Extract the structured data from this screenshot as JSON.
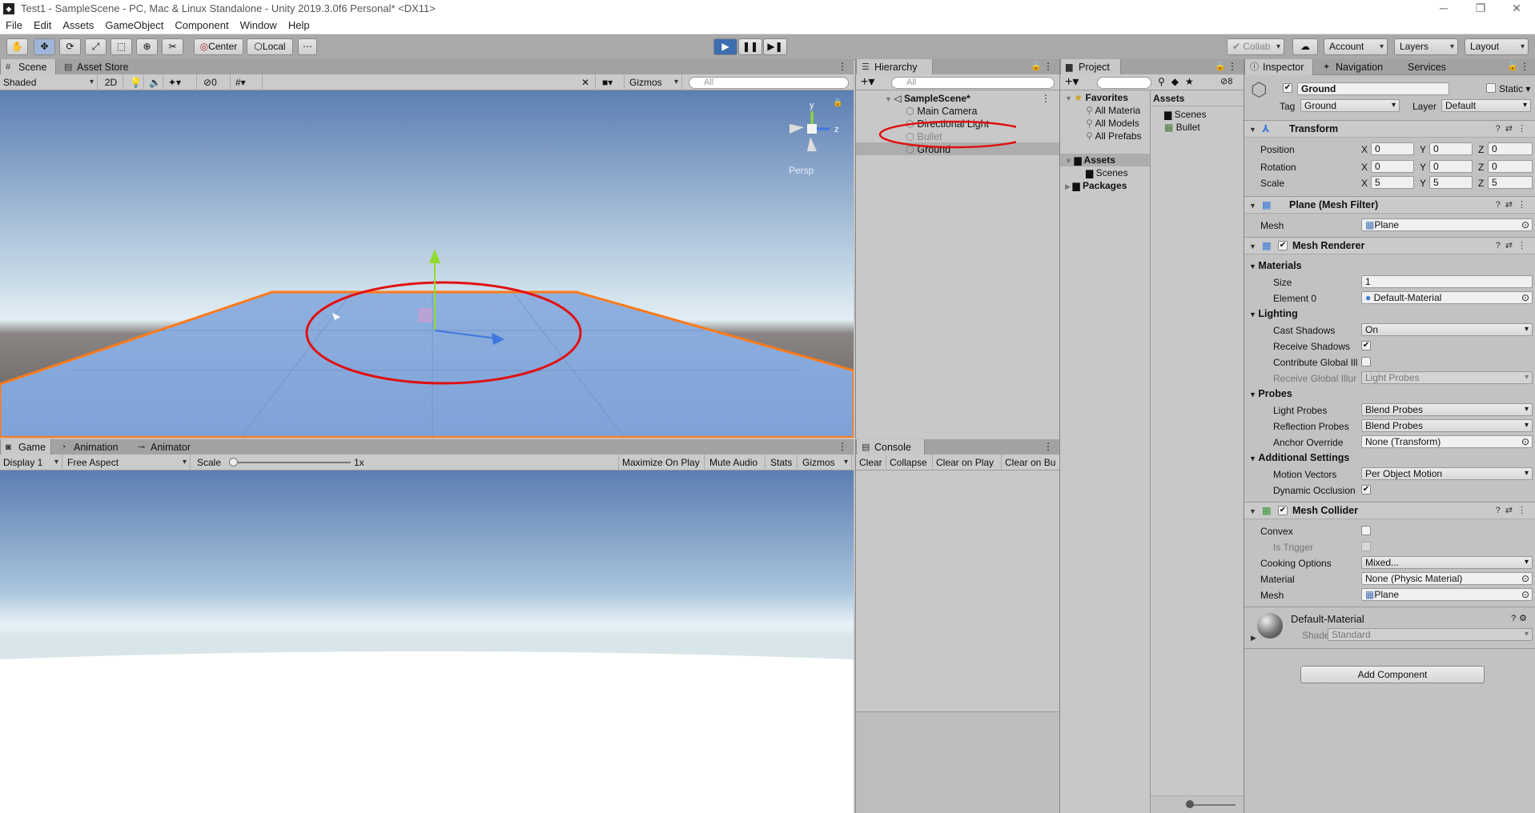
{
  "titlebar": {
    "title": "Test1 - SampleScene - PC, Mac & Linux Standalone - Unity 2019.3.0f6 Personal* <DX11>"
  },
  "menu": [
    "File",
    "Edit",
    "Assets",
    "GameObject",
    "Component",
    "Window",
    "Help"
  ],
  "toolbar": {
    "center": "Center",
    "local": "Local",
    "collab": "Collab",
    "account": "Account",
    "layers": "Layers",
    "layout": "Layout"
  },
  "scene": {
    "tabs": [
      "Scene",
      "Asset Store"
    ],
    "shading": "Shaded",
    "mode2d": "2D",
    "hidden_count": "0",
    "gizmos": "Gizmos",
    "search_placeholder": "All",
    "persp": "Persp",
    "axes": {
      "y": "y",
      "z": "z"
    }
  },
  "game": {
    "tabs": [
      "Game",
      "Animation",
      "Animator"
    ],
    "display": "Display 1",
    "aspect": "Free Aspect",
    "scale_label": "Scale",
    "scale_value": "1x",
    "buttons": [
      "Maximize On Play",
      "Mute Audio",
      "Stats",
      "Gizmos"
    ]
  },
  "hierarchy": {
    "tab": "Hierarchy",
    "search_placeholder": "All",
    "scene": "SampleScene*",
    "items": [
      "Main Camera",
      "Directional Light",
      "Bullet",
      "Ground"
    ]
  },
  "project": {
    "tab": "Project",
    "hidden_count": "8",
    "favorites": "Favorites",
    "fav_items": [
      "All Materia",
      "All Models",
      "All Prefabs"
    ],
    "assets": "Assets",
    "asset_tree": [
      "Scenes"
    ],
    "packages": "Packages",
    "right_header": "Assets",
    "right_items": [
      "Scenes",
      "Bullet"
    ]
  },
  "console": {
    "tab": "Console",
    "buttons": [
      "Clear",
      "Collapse",
      "Clear on Play",
      "Clear on Bu"
    ]
  },
  "inspector": {
    "tabs": [
      "Inspector",
      "Navigation",
      "Services"
    ],
    "object_name": "Ground",
    "static_label": "Static",
    "tag_label": "Tag",
    "tag_value": "Ground",
    "layer_label": "Layer",
    "layer_value": "Default",
    "transform": {
      "title": "Transform",
      "position": {
        "label": "Position",
        "x": "0",
        "y": "0",
        "z": "0"
      },
      "rotation": {
        "label": "Rotation",
        "x": "0",
        "y": "0",
        "z": "0"
      },
      "scale": {
        "label": "Scale",
        "x": "5",
        "y": "5",
        "z": "5"
      }
    },
    "mesh_filter": {
      "title": "Plane (Mesh Filter)",
      "mesh_label": "Mesh",
      "mesh_value": "Plane"
    },
    "mesh_renderer": {
      "title": "Mesh Renderer",
      "materials": "Materials",
      "size_label": "Size",
      "size_value": "1",
      "element0_label": "Element 0",
      "element0_value": "Default-Material",
      "lighting": "Lighting",
      "cast_shadows_label": "Cast Shadows",
      "cast_shadows_value": "On",
      "receive_shadows_label": "Receive Shadows",
      "contribute_gi_label": "Contribute Global Ill",
      "receive_gi_label": "Receive Global Illur",
      "receive_gi_value": "Light Probes",
      "probes": "Probes",
      "light_probes_label": "Light Probes",
      "light_probes_value": "Blend Probes",
      "reflection_probes_label": "Reflection Probes",
      "reflection_probes_value": "Blend Probes",
      "anchor_override_label": "Anchor Override",
      "anchor_override_value": "None (Transform)",
      "additional": "Additional Settings",
      "motion_vectors_label": "Motion Vectors",
      "motion_vectors_value": "Per Object Motion",
      "dynamic_occlusion_label": "Dynamic Occlusion"
    },
    "mesh_collider": {
      "title": "Mesh Collider",
      "convex_label": "Convex",
      "is_trigger_label": "Is Trigger",
      "cooking_label": "Cooking Options",
      "cooking_value": "Mixed...",
      "material_label": "Material",
      "material_value": "None (Physic Material)",
      "mesh_label": "Mesh",
      "mesh_value": "Plane"
    },
    "material": {
      "name": "Default-Material",
      "shader_label": "Shader",
      "shader_value": "Standard"
    },
    "add_component": "Add Component"
  }
}
